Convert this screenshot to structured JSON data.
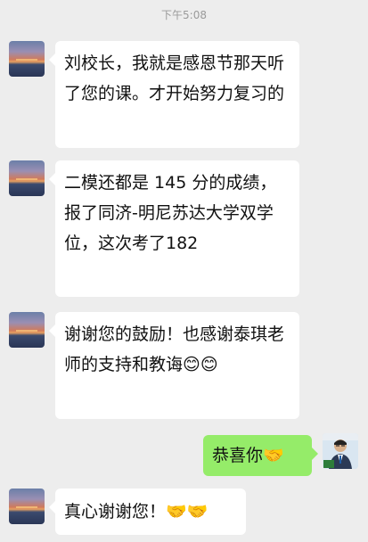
{
  "time": "下午5:08",
  "messages": [
    {
      "side": "left",
      "text": "刘校长，我就是感恩节那天听了您的课。才开始努力复习的"
    },
    {
      "side": "left",
      "text": "二模还都是 145 分的成绩，报了同济-明尼苏达大学双学位，这次考了182"
    },
    {
      "side": "left",
      "text": "谢谢您的鼓励！也感谢泰琪老师的支持和教诲",
      "emoji": "😊😊"
    },
    {
      "side": "right",
      "text": "恭喜你",
      "emoji": "🤝"
    },
    {
      "side": "left",
      "text": "真心谢谢您！",
      "emoji": "🤝🤝"
    }
  ]
}
